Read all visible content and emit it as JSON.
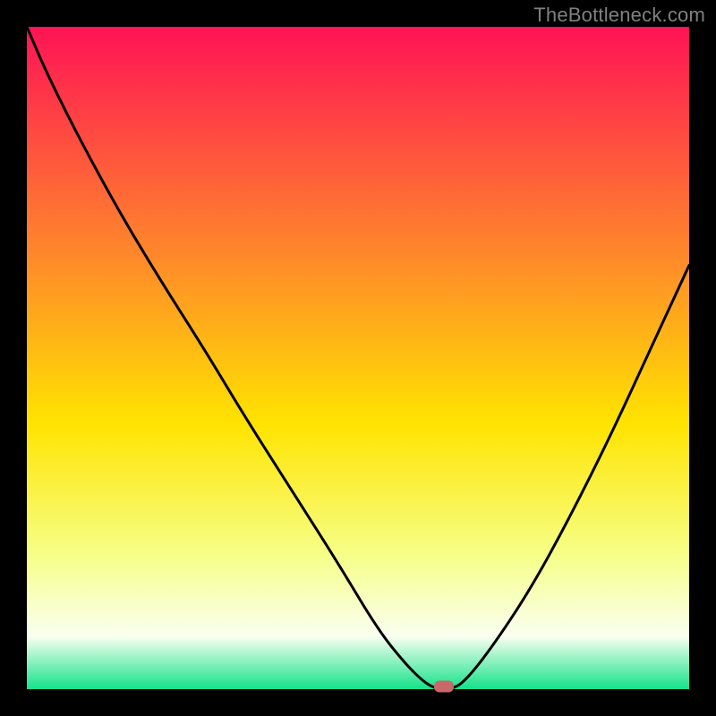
{
  "watermark": "TheBottleneck.com",
  "colors": {
    "top": "#ff1355",
    "upper_mid": "#ff8a2a",
    "mid": "#ffe400",
    "lower_mid": "#f6ff8a",
    "pale": "#fafff0",
    "bottom": "#14e28a",
    "curve": "#000000",
    "marker": "#c86868",
    "frame": "#000000"
  },
  "chart_data": {
    "type": "line",
    "title": "",
    "xlabel": "",
    "ylabel": "",
    "xlim": [
      0,
      100
    ],
    "ylim": [
      0,
      100
    ],
    "grid": false,
    "legend": false,
    "series": [
      {
        "name": "bottleneck-curve",
        "x": [
          0,
          3,
          8,
          14,
          20,
          27,
          33,
          40,
          47,
          53,
          57,
          60,
          62,
          64,
          66,
          70,
          76,
          82,
          88,
          94,
          100
        ],
        "y": [
          100,
          93,
          83,
          72,
          62,
          51,
          41,
          30,
          19,
          9,
          4,
          1,
          0,
          0,
          1,
          6,
          15,
          26,
          38,
          51,
          64
        ]
      }
    ],
    "markers": [
      {
        "name": "optimal-point",
        "x": 63,
        "y": 0
      }
    ],
    "gradient_bands": [
      {
        "pos": 0.0,
        "color": "#ff1355"
      },
      {
        "pos": 0.35,
        "color": "#ff8a2a"
      },
      {
        "pos": 0.6,
        "color": "#ffe400"
      },
      {
        "pos": 0.8,
        "color": "#f6ff8a"
      },
      {
        "pos": 0.92,
        "color": "#fafff0"
      },
      {
        "pos": 1.0,
        "color": "#14e28a"
      }
    ]
  }
}
